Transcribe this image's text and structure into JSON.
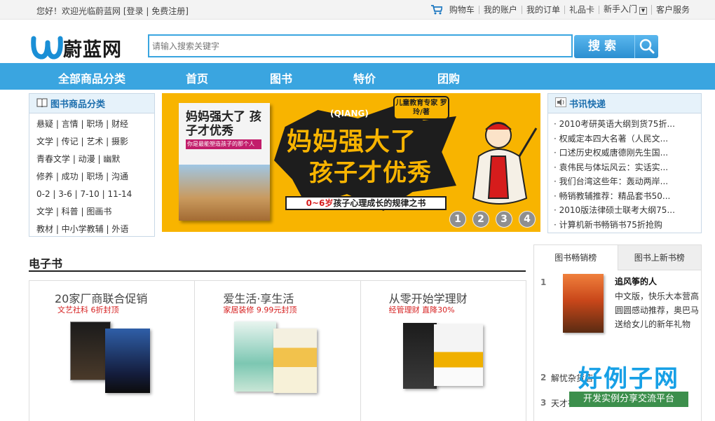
{
  "topbar": {
    "welcome": "您好！欢迎光临蔚蓝网",
    "login": "[登录",
    "register": "免费注册]",
    "links": [
      "购物车",
      "我的账户",
      "我的订单",
      "礼品卡",
      "新手入门",
      "客户服务"
    ]
  },
  "logo": {
    "name": "蔚蓝网"
  },
  "search": {
    "placeholder": "请输入搜索关键字",
    "button": "搜索"
  },
  "nav": {
    "all": "全部商品分类",
    "items": [
      "首页",
      "图书",
      "特价",
      "团购"
    ]
  },
  "left_panel": {
    "title": "图书商品分类",
    "rows": [
      "悬疑 | 言情 | 职场 | 财经",
      "文学 | 传记 | 艺术 | 摄影",
      "青春文学 | 动漫 | 幽默",
      "修养 | 成功 | 职场 | 沟通",
      "0-2 | 3-6 | 7-10 | 11-14",
      "文学 | 科普 | 图画书",
      "教材 | 中小学教辅 | 外语"
    ]
  },
  "banner": {
    "book_title": "妈妈强大了 孩子才优秀",
    "book_sub": "你是最能塑造孩子的那个人",
    "pinyin": "(QIANG)",
    "author": "儿童教育专家 罗玲/著",
    "line1": "妈妈强大了",
    "line2": "孩子才优秀",
    "strip_prefix": "0~6岁",
    "strip_text": "孩子心理成长的规律之书",
    "dots": [
      "1",
      "2",
      "3",
      "4"
    ]
  },
  "right_panel": {
    "title": "书讯快递",
    "news": [
      "· 2010考研英语大纲到货75折...",
      "· 权威定本四大名著（人民文...",
      "· 口述历史权威唐德刚先生国...",
      "· 袁伟民与体坛风云：实话实...",
      "· 我们台湾这些年：轰动两岸...",
      "· 畅销教辅推荐：精品套书50...",
      "· 2010版法律硕士联考大纲75...",
      "· 计算机新书畅销书75折抢购"
    ]
  },
  "ebook": {
    "title": "电子书",
    "cells": [
      {
        "heading": "20家厂商联合促销",
        "sub": "文艺社科 6折封顶"
      },
      {
        "heading": "爱生活·享生活",
        "sub": "家居装修 9.99元封顶"
      },
      {
        "heading": "从零开始学理财",
        "sub": "经管理财 直降30%"
      }
    ]
  },
  "rank": {
    "tabs": [
      "图书畅销榜",
      "图书上新书榜"
    ],
    "top": {
      "num": "1",
      "title": "追风筝的人",
      "desc": "中文版，快乐大本营高圆圆感动推荐，奥巴马送给女儿的新年礼物"
    },
    "others": [
      {
        "num": "2",
        "title": "解忧杂货店"
      },
      {
        "num": "3",
        "title": "天才在左"
      }
    ]
  },
  "watermark": {
    "big": "好例子网",
    "small": "开发实例分享交流平台"
  },
  "colors": {
    "brand_blue": "#3aa5e0",
    "promo_red": "#d62020",
    "banner_yellow": "#f8b400"
  }
}
